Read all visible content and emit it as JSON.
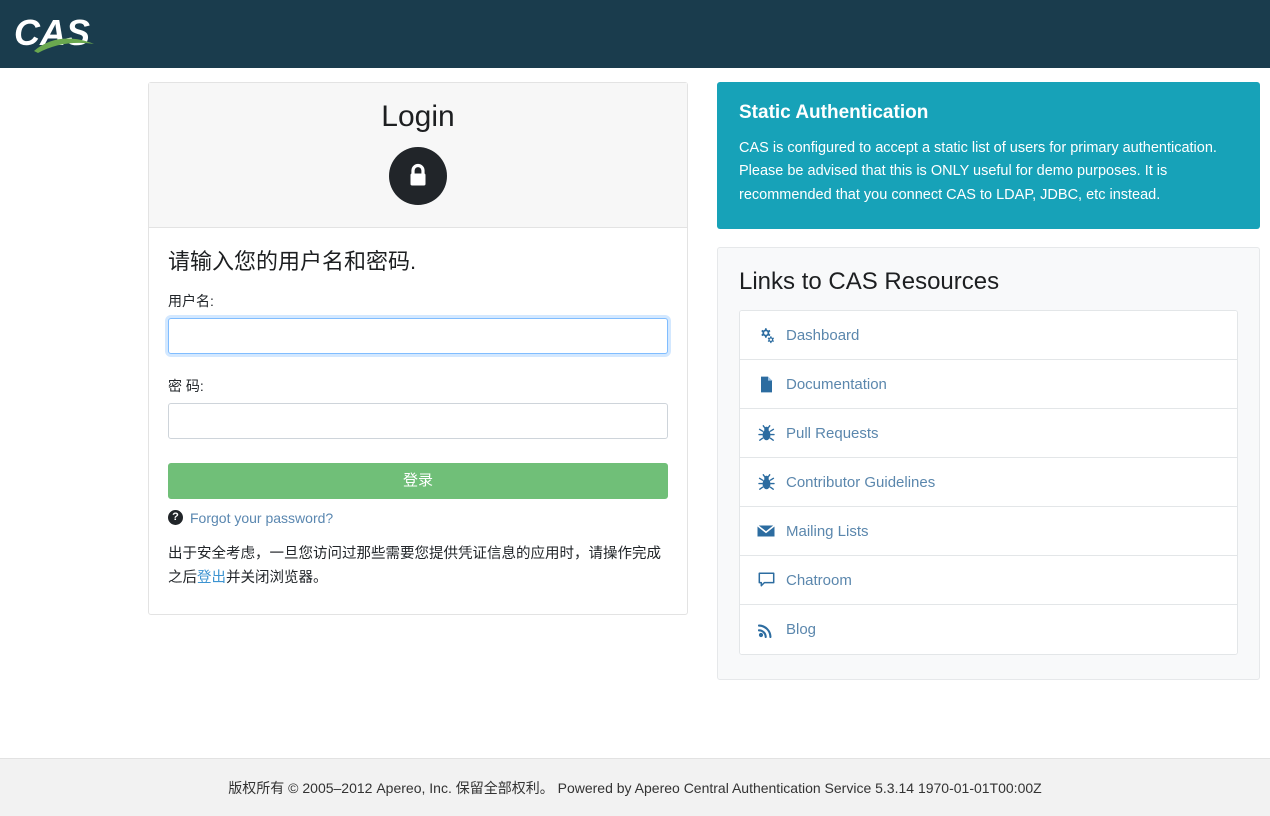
{
  "header": {
    "logo_text": "CAS",
    "logo_name": "cas-logo",
    "background_color": "#1a3c4d",
    "swoosh_color": "#6aa84f"
  },
  "login_card": {
    "title": "Login",
    "lock_icon": "lock-icon",
    "form_heading": "请输入您的用户名和密码.",
    "username": {
      "label": "用户名:",
      "value": "",
      "placeholder": "",
      "focused": true
    },
    "password": {
      "label": "密  码:",
      "value": "",
      "placeholder": "",
      "focused": false
    },
    "submit_label": "登录",
    "submit_color": "#70bf78",
    "forgot": {
      "icon": "question-circle-icon",
      "label": "Forgot your password?"
    },
    "security_note": {
      "part1": "出于安全考虑，一旦您访问过那些需要您提供凭证信息的应用时，请操作完成之后",
      "link": "登出",
      "part2": "并关闭浏览器。"
    }
  },
  "info_panel": {
    "title": "Static Authentication",
    "body": "CAS is configured to accept a static list of users for primary authentication. Please be advised that this is ONLY useful for demo purposes. It is recommended that you connect CAS to LDAP, JDBC, etc instead.",
    "background_color": "#17a2b8"
  },
  "resources": {
    "title": "Links to CAS Resources",
    "items": [
      {
        "label": "Dashboard",
        "icon": "cogs-icon"
      },
      {
        "label": "Documentation",
        "icon": "file-icon"
      },
      {
        "label": "Pull Requests",
        "icon": "bug-icon"
      },
      {
        "label": "Contributor Guidelines",
        "icon": "bug-icon"
      },
      {
        "label": "Mailing Lists",
        "icon": "envelope-icon"
      },
      {
        "label": "Chatroom",
        "icon": "comment-icon"
      },
      {
        "label": "Blog",
        "icon": "rss-icon"
      }
    ]
  },
  "footer": {
    "text": "版权所有 © 2005–2012 Apereo, Inc. 保留全部权利。 Powered by Apereo Central Authentication Service 5.3.14 1970-01-01T00:00Z"
  }
}
